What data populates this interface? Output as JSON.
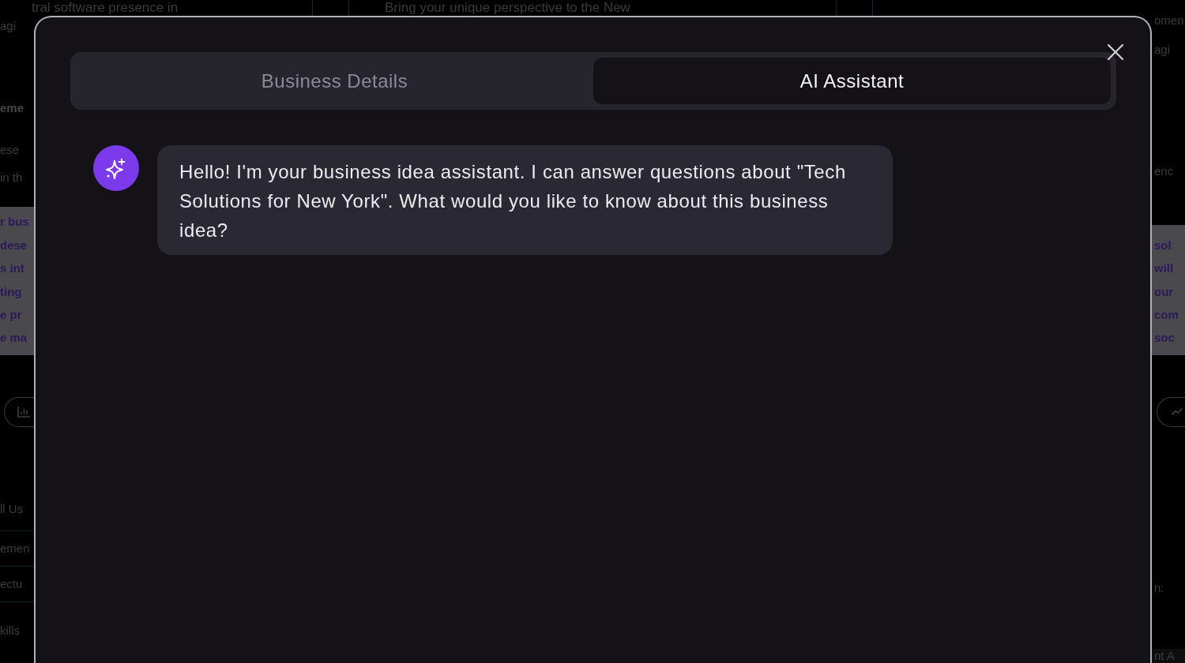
{
  "background_page": {
    "top_texts": [
      "tral software presence in",
      "Bring your unique perspective to the New"
    ],
    "left_edge": {
      "paragraph_lines": [
        "agi"
      ],
      "heading": "eme",
      "description_lines": [
        "ese",
        "in th"
      ],
      "highlight_lines": [
        "r bus",
        "dese",
        "s int",
        "ting",
        "e pr",
        "e ma"
      ],
      "list_title": "ll Us",
      "list_items": [
        "emen",
        "ectu"
      ],
      "label": "kills"
    },
    "right_edge": {
      "paragraph_lines": [
        "omen",
        "agi"
      ],
      "description_lines": [
        "enc"
      ],
      "highlight_lines": [
        "sol",
        "will",
        "our",
        "com",
        "soc"
      ],
      "label": "n:",
      "footer_text": "nt A"
    }
  },
  "modal": {
    "tabs": [
      {
        "label": "Business Details",
        "selected": false
      },
      {
        "label": "AI Assistant",
        "selected": true
      }
    ],
    "messages": [
      {
        "kind": "incoming",
        "text": "Hello! I'm your business idea assistant. I can answer questions about \"Tech Solutions for New York\". What would you like to know about this business idea?"
      }
    ]
  }
}
